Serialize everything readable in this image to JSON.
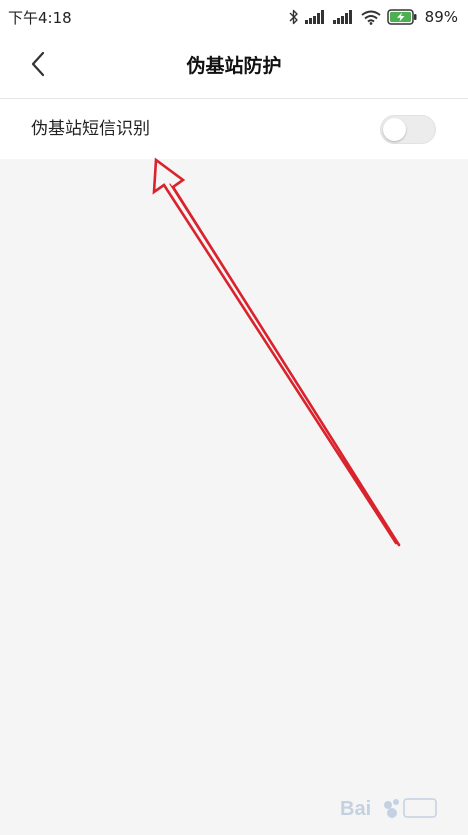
{
  "status_bar": {
    "time": "下午4:18",
    "battery_percent": "89%",
    "icons": [
      "bluetooth-icon",
      "signal-icon",
      "signal-icon",
      "wifi-icon",
      "battery-charging-icon"
    ],
    "battery_color": "#4caf50"
  },
  "header": {
    "title": "伪基站防护",
    "back_icon": "chevron-left-icon"
  },
  "settings": {
    "items": [
      {
        "label": "伪基站短信识别",
        "enabled": false
      }
    ]
  },
  "annotation": {
    "color": "#d9232d",
    "shape": "arrow pointing to toggle row label"
  },
  "watermark": {
    "text": "Bai 经验"
  }
}
